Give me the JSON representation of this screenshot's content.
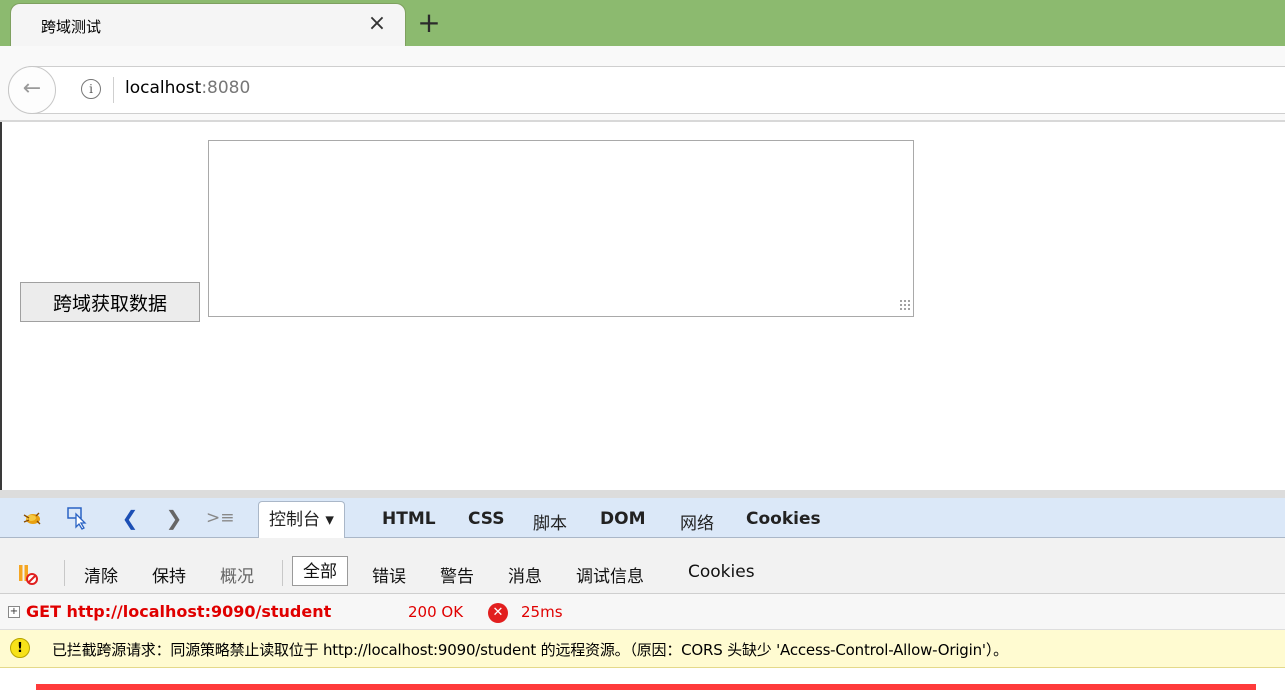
{
  "browser": {
    "tab_title": "跨域测试",
    "tab_close_glyph": "×",
    "new_tab_glyph": "+",
    "url_host": "localhost",
    "url_port": ":8080",
    "accent_color": "#8cba6f"
  },
  "page": {
    "fetch_button_label": "跨域获取数据",
    "textarea_value": ""
  },
  "firebug": {
    "tabs": [
      {
        "label": "控制台 ▾",
        "active": true
      },
      {
        "label": "HTML"
      },
      {
        "label": "CSS"
      },
      {
        "label": "脚本"
      },
      {
        "label": "DOM"
      },
      {
        "label": "网络"
      },
      {
        "label": "Cookies"
      }
    ],
    "console_bar": {
      "clear": "清除",
      "persist": "保持",
      "profile": "概况",
      "all": "全部",
      "errors": "错误",
      "warnings": "警告",
      "info": "消息",
      "debug": "调试信息",
      "cookies": "Cookies"
    },
    "request": {
      "expand_glyph": "+",
      "method_url": "GET http://localhost:9090/student",
      "status": "200 OK",
      "time": "25ms",
      "status_color": "#e00000"
    },
    "warning": {
      "icon": "!",
      "message": "已拦截跨源请求：同源策略禁止读取位于 http://localhost:9090/student 的远程资源。（原因：CORS 头缺少 'Access-Control-Allow-Origin'）。"
    }
  }
}
